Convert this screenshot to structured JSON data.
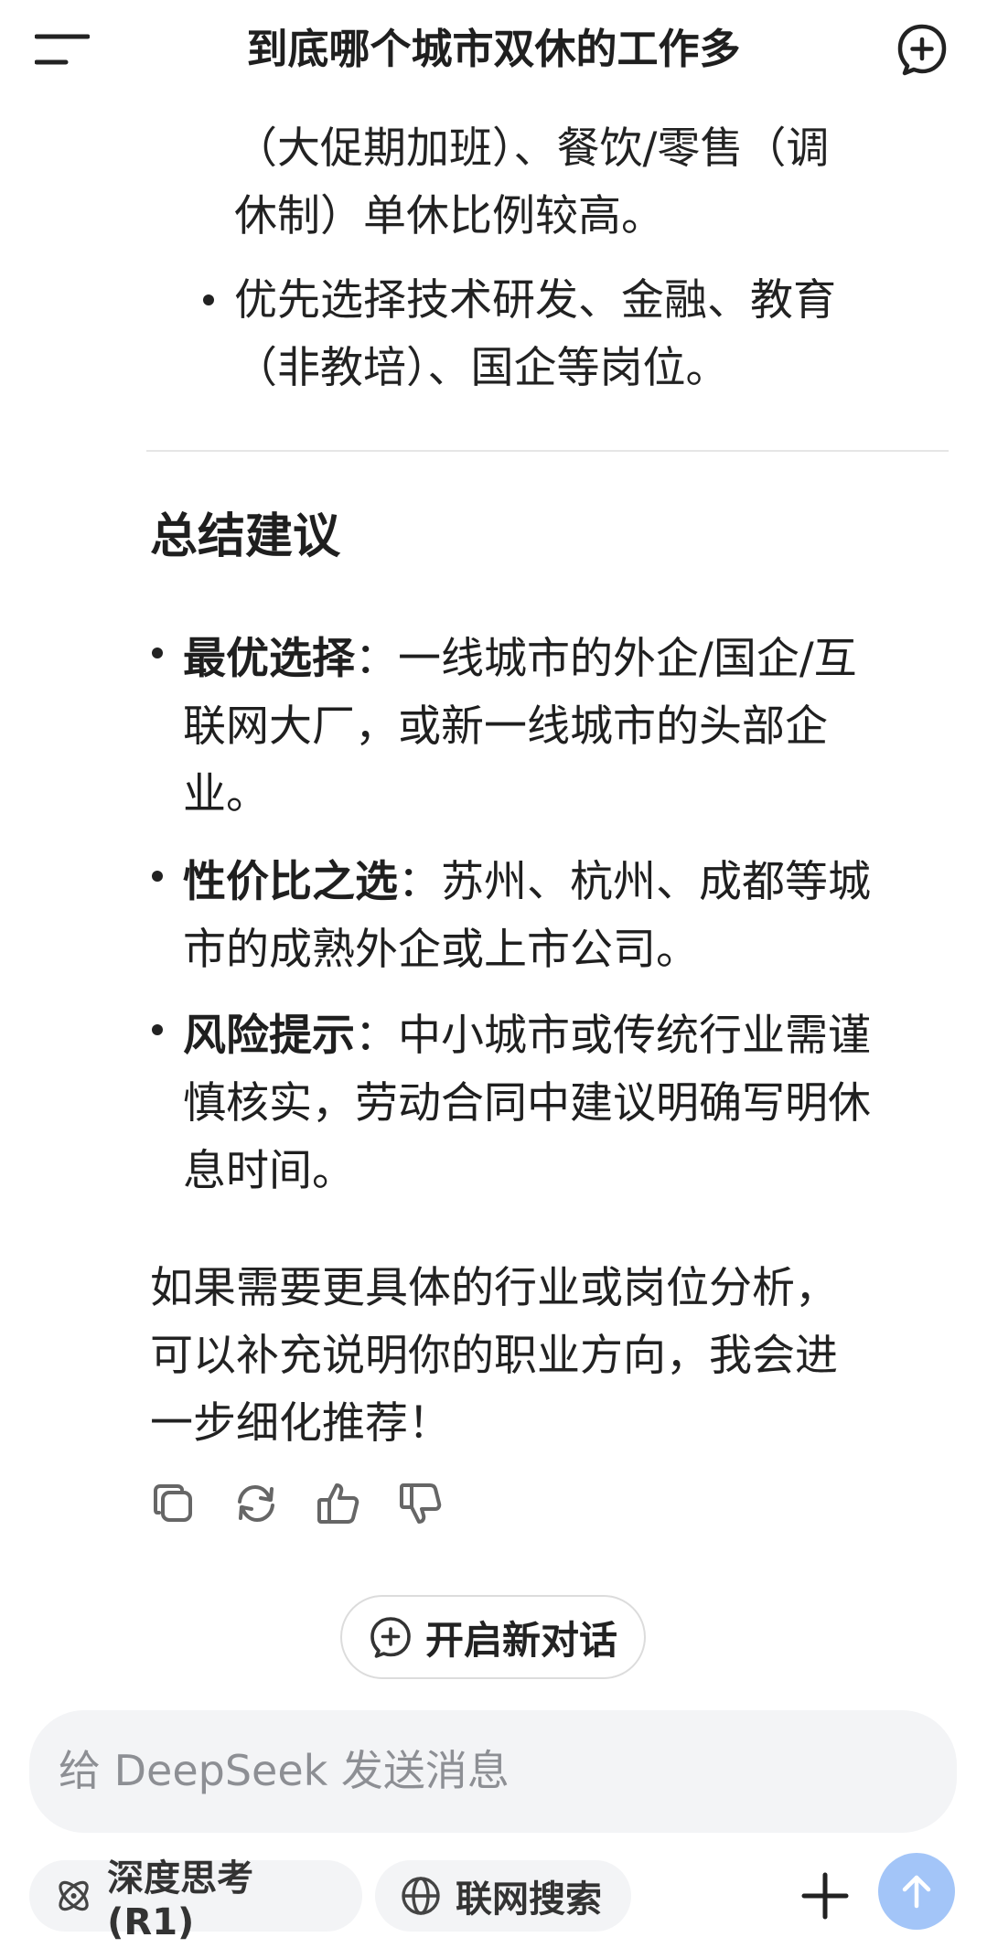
{
  "header": {
    "title": "到底哪个城市双休的工作多"
  },
  "prev_block": {
    "line1": "（大促期加班）、餐饮/零售（调",
    "line2": "休制）单休比例较高。",
    "bullet_line1": "优先选择技术研发、金融、教育",
    "bullet_line2": "（非教培）、国企等岗位。"
  },
  "summary": {
    "title": "总结建议",
    "items": [
      {
        "label": "最优选择",
        "sep": "：",
        "line1": "一线城市的外企/国企/互",
        "line2": "联网大厂，或新一线城市的头部企",
        "line3": "业。"
      },
      {
        "label": "性价比之选",
        "sep": "：",
        "line1": "苏州、杭州、成都等城",
        "line2": "市的成熟外企或上市公司。"
      },
      {
        "label": "风险提示",
        "sep": "：",
        "line1": "中小城市或传统行业需谨",
        "line2": "慎核实，劳动合同中建议明确写明休",
        "line3": "息时间。"
      }
    ],
    "closing_line1": "如果需要更具体的行业或岗位分析，",
    "closing_line2": "可以补充说明你的职业方向，我会进",
    "closing_line3": "一步细化推荐！"
  },
  "actions": {
    "copy": "copy-icon",
    "regenerate": "refresh-icon",
    "like": "thumbs-up-icon",
    "dislike": "thumbs-down-icon"
  },
  "new_chat_label": "开启新对话",
  "input": {
    "placeholder": "给 DeepSeek 发送消息"
  },
  "controls": {
    "deep_think": "深度思考 (R1)",
    "web_search": "联网搜索"
  },
  "colors": {
    "send_button": "#a3c5f8",
    "input_bg": "#f3f4f6"
  }
}
